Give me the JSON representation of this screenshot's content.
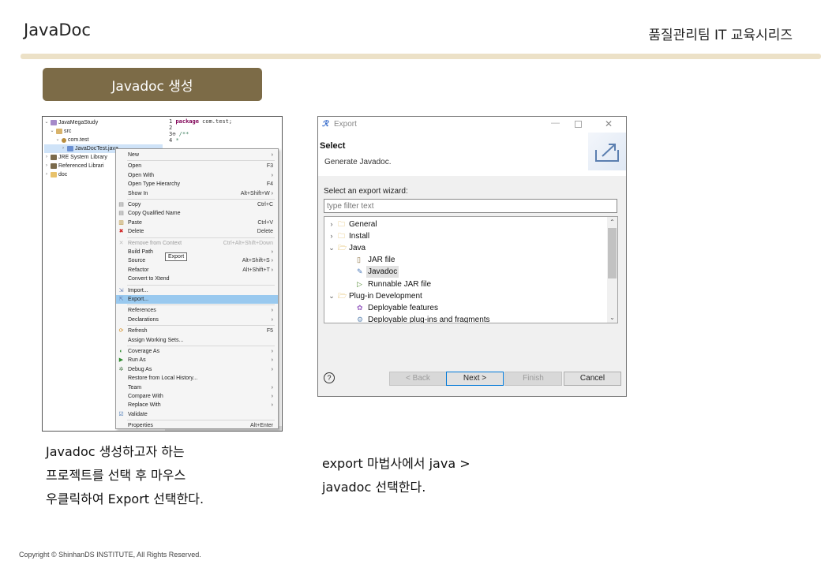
{
  "header": {
    "title": "JavaDoc",
    "series": "품질관리팀 IT 교육시리즈"
  },
  "section": {
    "label": "Javadoc 생성"
  },
  "eclipse": {
    "tree": [
      {
        "twisty": "⌄",
        "icon": "proj",
        "label": "JavaMegaStudy",
        "indent": 0
      },
      {
        "twisty": "⌄",
        "icon": "src",
        "label": "src",
        "indent": 1
      },
      {
        "twisty": "⌄",
        "icon": "pkg",
        "label": "com.test",
        "indent": 2
      },
      {
        "twisty": "›",
        "icon": "java",
        "label": "JavaDocTest.java",
        "indent": 3,
        "selected": true
      },
      {
        "twisty": "›",
        "icon": "lib",
        "label": "JRE System Library",
        "indent": 0
      },
      {
        "twisty": "›",
        "icon": "lib",
        "label": "Referenced Librari",
        "indent": 0
      },
      {
        "twisty": "›",
        "icon": "fold",
        "label": "doc",
        "indent": 0
      }
    ],
    "code": [
      {
        "num": "1",
        "kw": "package",
        "text": " com.test;"
      },
      {
        "num": "2",
        "kw": "",
        "text": ""
      },
      {
        "num": "3⊖",
        "kw": "",
        "text": "/**"
      },
      {
        "num": "4",
        "kw": "",
        "text": " *"
      }
    ],
    "menu": [
      {
        "label": "New",
        "shortcut": "›"
      },
      {
        "sep": true
      },
      {
        "label": "Open",
        "shortcut": "F3"
      },
      {
        "label": "Open With",
        "shortcut": "›"
      },
      {
        "label": "Open Type Hierarchy",
        "shortcut": "F4"
      },
      {
        "label": "Show In",
        "shortcut": "Alt+Shift+W ›"
      },
      {
        "sep": true
      },
      {
        "label": "Copy",
        "shortcut": "Ctrl+C",
        "icon": "copy"
      },
      {
        "label": "Copy Qualified Name",
        "shortcut": "",
        "icon": "copy"
      },
      {
        "label": "Paste",
        "shortcut": "Ctrl+V",
        "icon": "paste"
      },
      {
        "label": "Delete",
        "shortcut": "Delete",
        "icon": "delete"
      },
      {
        "sep": true
      },
      {
        "label": "Remove from Context",
        "shortcut": "Ctrl+Alt+Shift+Down",
        "disabled": true,
        "icon": "remove"
      },
      {
        "label": "Build Path",
        "shortcut": "›"
      },
      {
        "label": "Source",
        "shortcut": "Alt+Shift+S ›"
      },
      {
        "label": "Refactor",
        "shortcut": "Alt+Shift+T ›"
      },
      {
        "label": "Convert to Xtend",
        "shortcut": ""
      },
      {
        "sep": true
      },
      {
        "label": "Import...",
        "shortcut": "",
        "icon": "import"
      },
      {
        "label": "Export...",
        "shortcut": "",
        "icon": "export",
        "highlight": true
      },
      {
        "sep": true
      },
      {
        "label": "References",
        "shortcut": "›"
      },
      {
        "label": "Declarations",
        "shortcut": "›"
      },
      {
        "sep": true
      },
      {
        "label": "Refresh",
        "shortcut": "F5",
        "icon": "refresh"
      },
      {
        "label": "Assign Working Sets...",
        "shortcut": ""
      },
      {
        "sep": true
      },
      {
        "label": "Coverage As",
        "shortcut": "›",
        "icon": "coverage"
      },
      {
        "label": "Run As",
        "shortcut": "›",
        "icon": "run"
      },
      {
        "label": "Debug As",
        "shortcut": "›",
        "icon": "debug"
      },
      {
        "label": "Restore from Local History...",
        "shortcut": ""
      },
      {
        "label": "Team",
        "shortcut": "›"
      },
      {
        "label": "Compare With",
        "shortcut": "›"
      },
      {
        "label": "Replace With",
        "shortcut": "›"
      },
      {
        "label": "Validate",
        "shortcut": "",
        "icon": "validate"
      },
      {
        "sep": true
      },
      {
        "label": "Properties",
        "shortcut": "Alt+Enter"
      }
    ],
    "tooltip": "Export"
  },
  "dialog": {
    "title": "Export",
    "heading": "Select",
    "description": "Generate Javadoc.",
    "wizard_label": "Select an export wizard:",
    "filter_placeholder": "type filter text",
    "tree": [
      {
        "twisty": "›",
        "icon": "folder",
        "label": "General",
        "indent": 0
      },
      {
        "twisty": "›",
        "icon": "folder",
        "label": "Install",
        "indent": 0
      },
      {
        "twisty": "⌄",
        "icon": "folder-open",
        "label": "Java",
        "indent": 0
      },
      {
        "twisty": "",
        "icon": "jar",
        "label": "JAR file",
        "indent": 1
      },
      {
        "twisty": "",
        "icon": "javadoc",
        "label": "Javadoc",
        "indent": 1,
        "selected": true
      },
      {
        "twisty": "",
        "icon": "runjar",
        "label": "Runnable JAR file",
        "indent": 1
      },
      {
        "twisty": "⌄",
        "icon": "folder-open",
        "label": "Plug-in Development",
        "indent": 0
      },
      {
        "twisty": "",
        "icon": "feature",
        "label": "Deployable features",
        "indent": 1
      },
      {
        "twisty": "",
        "icon": "plugin",
        "label": "Deployable plug-ins and fragments",
        "indent": 1
      }
    ],
    "buttons": {
      "back": "< Back",
      "next": "Next >",
      "finish": "Finish",
      "cancel": "Cancel"
    },
    "help": "?"
  },
  "captions": {
    "left": [
      "Javadoc 생성하고자 하는",
      "프로젝트를 선택 후 마우스",
      "우클릭하여 Export 선택한다."
    ],
    "right": [
      "export 마법사에서 java >",
      "javadoc 선택한다."
    ]
  },
  "footer": "Copyright © ShinhanDS INSTITUTE, All Rights Reserved.",
  "colors": {
    "badge": "#7c6b47",
    "rule": "#ece1c7",
    "menu_highlight": "#99c9ef",
    "default_button_border": "#0078d7"
  }
}
